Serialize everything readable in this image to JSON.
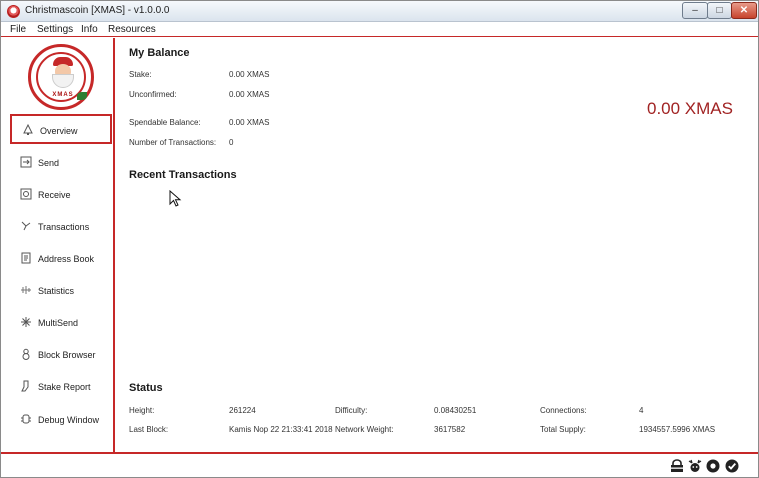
{
  "window": {
    "title": "Christmascoin [XMAS] - v1.0.0.0",
    "controls": {
      "minimize": "‒",
      "maximize": "□",
      "close": "✕"
    }
  },
  "menu": [
    "File",
    "Settings",
    "Info",
    "Resources"
  ],
  "logo": {
    "text": "XMAS"
  },
  "sidebar": {
    "items": [
      {
        "label": "Overview",
        "icon": "tree-icon"
      },
      {
        "label": "Send",
        "icon": "send-icon"
      },
      {
        "label": "Receive",
        "icon": "receive-icon"
      },
      {
        "label": "Transactions",
        "icon": "transactions-icon"
      },
      {
        "label": "Address Book",
        "icon": "address-book-icon"
      },
      {
        "label": "Statistics",
        "icon": "statistics-icon"
      },
      {
        "label": "MultiSend",
        "icon": "snowflake-icon"
      },
      {
        "label": "Block Browser",
        "icon": "snowman-icon"
      },
      {
        "label": "Stake Report",
        "icon": "stocking-icon"
      },
      {
        "label": "Debug Window",
        "icon": "debug-icon"
      }
    ]
  },
  "balance": {
    "title": "My Balance",
    "rows": [
      {
        "label": "Stake:",
        "value": "0.00 XMAS"
      },
      {
        "label": "Unconfirmed:",
        "value": "0.00 XMAS"
      },
      {
        "label": "Spendable Balance:",
        "value": "0.00 XMAS"
      },
      {
        "label": "Number of Transactions:",
        "value": "0"
      }
    ],
    "total": "0.00 XMAS"
  },
  "recent": {
    "title": "Recent Transactions"
  },
  "status": {
    "title": "Status",
    "height_label": "Height:",
    "height_value": "261224",
    "difficulty_label": "Difficulty:",
    "difficulty_value": "0.08430251",
    "connections_label": "Connections:",
    "connections_value": "4",
    "last_block_label": "Last Block:",
    "last_block_value": "Kamis Nop 22 21:33:41 2018",
    "network_weight_label": "Network Weight:",
    "network_weight_value": "3617582",
    "total_supply_label": "Total Supply:",
    "total_supply_value": "1934557.5996 XMAS"
  },
  "colors": {
    "accent": "#c62828",
    "balance_total": "#a12323"
  }
}
